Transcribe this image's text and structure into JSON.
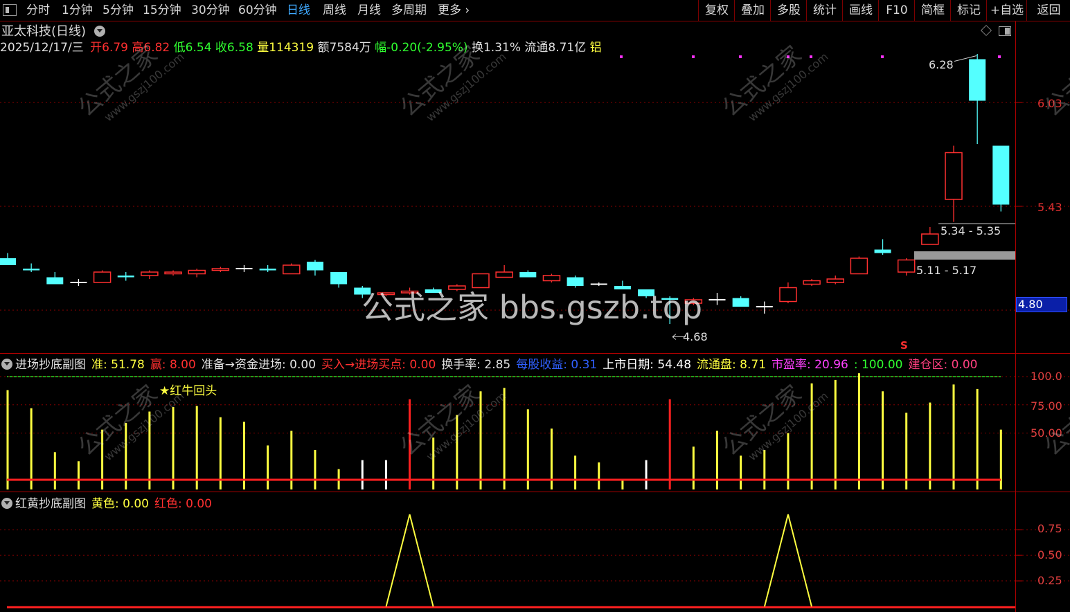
{
  "toolbar": {
    "left_items": [
      "分时",
      "1分钟",
      "5分钟",
      "15分钟",
      "30分钟",
      "60分钟",
      "日线",
      "周线",
      "月线",
      "多周期",
      "更多"
    ],
    "active_index": 6,
    "right_items": [
      "复权",
      "叠加",
      "多股",
      "统计",
      "画线",
      "F10",
      "简框",
      "标记",
      "+自选",
      "返回"
    ]
  },
  "stock": {
    "name": "亚太科技(日线)",
    "date": "2025/12/17/三",
    "open_label": "开",
    "open": "6.79",
    "high_label": "高",
    "high": "6.82",
    "low_label": "低",
    "low": "6.54",
    "close_label": "收",
    "close": "6.58",
    "vol_label": "量",
    "vol": "114319",
    "amount_label": "额",
    "amount": "7584万",
    "change_label": "幅",
    "change": "-0.20(-2.95%)",
    "turnover_label": "换",
    "turnover": "1.31%",
    "float_label": "流通",
    "float": "8.71亿",
    "sector": "铝"
  },
  "main_chart": {
    "y_ticks": [
      "6.03",
      "5.43"
    ],
    "price_tag": "4.80",
    "annotations": {
      "high_label": "6.28",
      "low_label": "4.68",
      "zone1": "5.34 - 5.35",
      "zone2": "5.11 - 5.17",
      "signal_mark": "S"
    },
    "watermark_big": "公式之家 bbs.gszb.top",
    "watermark_small": "公式之家",
    "watermark_url": "www.gszj100.com"
  },
  "chart_data": {
    "type": "candlestick",
    "candles": [
      {
        "o": 5.13,
        "h": 5.16,
        "l": 5.09,
        "c": 5.09
      },
      {
        "o": 5.07,
        "h": 5.1,
        "l": 5.05,
        "c": 5.06
      },
      {
        "o": 5.02,
        "h": 5.05,
        "l": 4.98,
        "c": 4.98
      },
      {
        "o": 4.99,
        "h": 5.01,
        "l": 4.97,
        "c": 4.99
      },
      {
        "o": 4.99,
        "h": 5.06,
        "l": 4.99,
        "c": 5.05
      },
      {
        "o": 5.03,
        "h": 5.05,
        "l": 5.0,
        "c": 5.02
      },
      {
        "o": 5.03,
        "h": 5.06,
        "l": 5.01,
        "c": 5.05
      },
      {
        "o": 5.04,
        "h": 5.06,
        "l": 5.03,
        "c": 5.05
      },
      {
        "o": 5.04,
        "h": 5.07,
        "l": 5.02,
        "c": 5.06
      },
      {
        "o": 5.06,
        "h": 5.08,
        "l": 5.05,
        "c": 5.07
      },
      {
        "o": 5.07,
        "h": 5.09,
        "l": 5.05,
        "c": 5.07
      },
      {
        "o": 5.07,
        "h": 5.09,
        "l": 5.05,
        "c": 5.06
      },
      {
        "o": 5.04,
        "h": 5.1,
        "l": 5.04,
        "c": 5.09
      },
      {
        "o": 5.11,
        "h": 5.12,
        "l": 5.03,
        "c": 5.06
      },
      {
        "o": 5.05,
        "h": 5.05,
        "l": 4.96,
        "c": 4.98
      },
      {
        "o": 4.96,
        "h": 4.97,
        "l": 4.9,
        "c": 4.92
      },
      {
        "o": 4.92,
        "h": 4.93,
        "l": 4.91,
        "c": 4.93
      },
      {
        "o": 4.93,
        "h": 4.96,
        "l": 4.92,
        "c": 4.94
      },
      {
        "o": 4.95,
        "h": 4.96,
        "l": 4.93,
        "c": 4.93
      },
      {
        "o": 4.95,
        "h": 4.98,
        "l": 4.94,
        "c": 4.97
      },
      {
        "o": 4.96,
        "h": 5.04,
        "l": 4.96,
        "c": 5.04
      },
      {
        "o": 5.02,
        "h": 5.09,
        "l": 5.02,
        "c": 5.05
      },
      {
        "o": 5.05,
        "h": 5.06,
        "l": 5.02,
        "c": 5.02
      },
      {
        "o": 5.0,
        "h": 5.04,
        "l": 4.99,
        "c": 5.03
      },
      {
        "o": 5.02,
        "h": 5.03,
        "l": 4.96,
        "c": 4.97
      },
      {
        "o": 4.98,
        "h": 4.99,
        "l": 4.97,
        "c": 4.98
      },
      {
        "o": 4.97,
        "h": 5.0,
        "l": 4.95,
        "c": 4.95
      },
      {
        "o": 4.95,
        "h": 4.95,
        "l": 4.9,
        "c": 4.91
      },
      {
        "o": 4.9,
        "h": 4.91,
        "l": 4.75,
        "c": 4.89
      },
      {
        "o": 4.87,
        "h": 4.9,
        "l": 4.86,
        "c": 4.89
      },
      {
        "o": 4.89,
        "h": 4.93,
        "l": 4.86,
        "c": 4.89
      },
      {
        "o": 4.9,
        "h": 4.91,
        "l": 4.85,
        "c": 4.85
      },
      {
        "o": 4.85,
        "h": 4.88,
        "l": 4.81,
        "c": 4.85
      },
      {
        "o": 4.88,
        "h": 4.99,
        "l": 4.87,
        "c": 4.96
      },
      {
        "o": 4.98,
        "h": 5.01,
        "l": 4.97,
        "c": 5.0
      },
      {
        "o": 4.99,
        "h": 5.03,
        "l": 4.98,
        "c": 5.01
      },
      {
        "o": 5.04,
        "h": 5.14,
        "l": 5.04,
        "c": 5.13
      },
      {
        "o": 5.18,
        "h": 5.24,
        "l": 5.15,
        "c": 5.16
      },
      {
        "o": 5.05,
        "h": 5.13,
        "l": 5.03,
        "c": 5.12
      },
      {
        "o": 5.21,
        "h": 5.31,
        "l": 5.21,
        "c": 5.27
      },
      {
        "o": 5.47,
        "h": 5.78,
        "l": 5.34,
        "c": 5.74
      },
      {
        "o": 6.28,
        "h": 6.31,
        "l": 5.79,
        "c": 6.04
      },
      {
        "o": 5.78,
        "h": 5.78,
        "l": 5.4,
        "c": 5.44
      }
    ]
  },
  "ind1": {
    "title": "进场抄底副图",
    "items": [
      {
        "label": "准:",
        "value": "51.78",
        "color": "#ffff40"
      },
      {
        "label": "赢:",
        "value": "8.00",
        "color": "#ff3030"
      },
      {
        "label": "准备→资金进场:",
        "value": "0.00",
        "color": "#e0e0e0"
      },
      {
        "label": "买入→进场买点:",
        "value": "0.00",
        "color": "#ff3030"
      },
      {
        "label": "换手率:",
        "value": "2.85",
        "color": "#e0e0e0"
      },
      {
        "label": "每股收益:",
        "value": "0.31",
        "color": "#3060ff"
      },
      {
        "label": "上市日期:",
        "value": "54.48",
        "color": "#ffffff"
      },
      {
        "label": "流通盘:",
        "value": "8.71",
        "color": "#ffff40"
      },
      {
        "label": "市盈率:",
        "value": "20.96",
        "color": "#ff40ff"
      },
      {
        "label": ":",
        "value": "100.00",
        "color": "#30ff30"
      },
      {
        "label": "建仓区:",
        "value": "0.00",
        "color": "#ff4080"
      }
    ],
    "note": "★红牛回头",
    "y_ticks": [
      "100.0",
      "75.00",
      "50.00"
    ],
    "bars": [
      88,
      72,
      33,
      25,
      53,
      59,
      69,
      73,
      74,
      64,
      60,
      39,
      52,
      35,
      18,
      26,
      26,
      80,
      46,
      66,
      87,
      90,
      71,
      54,
      30,
      24,
      9,
      26,
      80,
      38,
      52,
      30,
      35,
      50,
      94,
      97,
      103,
      87,
      68,
      77,
      93,
      89,
      53
    ],
    "bar_colors": [
      "y",
      "y",
      "y",
      "y",
      "y",
      "y",
      "y",
      "y",
      "y",
      "y",
      "y",
      "y",
      "y",
      "y",
      "y",
      "w",
      "w",
      "r",
      "y",
      "y",
      "y",
      "y",
      "y",
      "y",
      "y",
      "y",
      "y",
      "w",
      "r",
      "y",
      "y",
      "y",
      "y",
      "y",
      "y",
      "y",
      "y",
      "y",
      "y",
      "y",
      "y",
      "y",
      "y"
    ]
  },
  "ind2": {
    "title": "红黄抄底副图",
    "items": [
      {
        "label": "黄色:",
        "value": "0.00",
        "color": "#ffff40"
      },
      {
        "label": "红色:",
        "value": "0.00",
        "color": "#ff3030"
      }
    ],
    "y_ticks": [
      "0.75",
      "0.50",
      "0.25"
    ],
    "peaks": [
      17,
      33
    ]
  },
  "colors": {
    "up": "#ff3030",
    "down": "#54ffff",
    "flat": "#ffffff",
    "grid": "#8b0000",
    "yellow": "#ffff40"
  }
}
